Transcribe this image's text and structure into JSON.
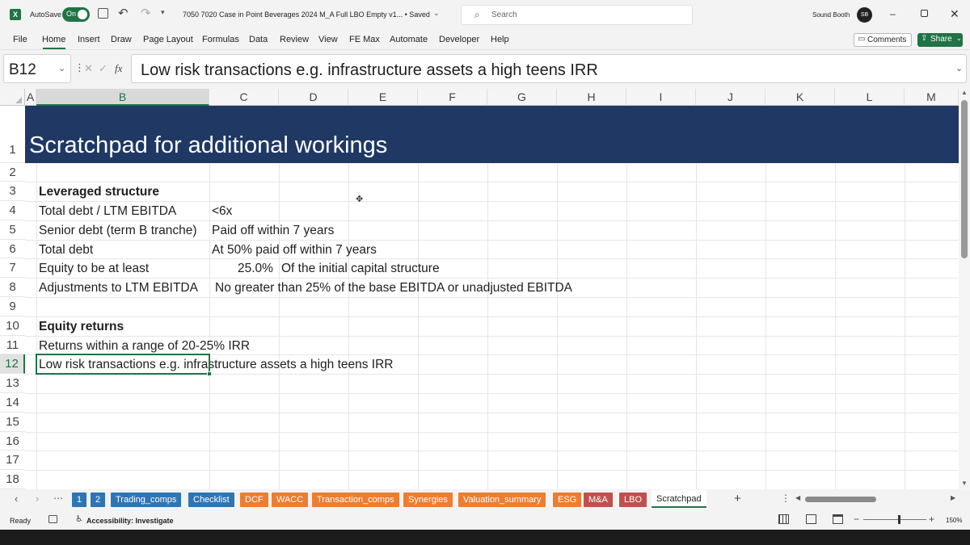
{
  "titlebar": {
    "autosave_label": "AutoSave",
    "autosave_state": "On",
    "document_title": "7050 7020 Case in Point Beverages 2024 M_A Full LBO Empty v1... • Saved",
    "search_placeholder": "Search",
    "user_name": "Sound Booth",
    "user_initials": "SB"
  },
  "ribbon": {
    "tabs": [
      "File",
      "Home",
      "Insert",
      "Draw",
      "Page Layout",
      "Formulas",
      "Data",
      "Review",
      "View",
      "FE Max",
      "Automate",
      "Developer",
      "Help"
    ],
    "comments_label": "Comments",
    "share_label": "Share"
  },
  "formula_bar": {
    "name_box": "B12",
    "fx_label": "fx",
    "content": "Low risk transactions e.g. infrastructure assets a high teens IRR"
  },
  "columns": [
    "A",
    "B",
    "C",
    "D",
    "E",
    "F",
    "G",
    "H",
    "I",
    "J",
    "K",
    "L",
    "M"
  ],
  "rows": [
    "1",
    "2",
    "3",
    "4",
    "5",
    "6",
    "7",
    "8",
    "9",
    "10",
    "11",
    "12",
    "13",
    "14",
    "15",
    "16",
    "17",
    "18"
  ],
  "cells": {
    "b1": "Scratchpad for additional workings",
    "b3": "Leveraged structure",
    "b4": "Total debt / LTM EBITDA",
    "c4": "<6x",
    "b5": "Senior debt (term B tranche)",
    "c5": "Paid off within 7 years",
    "b6": "Total debt",
    "c6": "At 50% paid off within 7 years",
    "b7": "Equity to be at least",
    "c7": "25.0%",
    "d7": "Of the initial capital structure",
    "b8": "Adjustments to LTM EBITDA",
    "c8": "No greater than 25% of the base EBITDA or unadjusted EBITDA",
    "b10": "Equity returns",
    "b11": "Returns within a range of 20-25% IRR",
    "b12": "Low risk transactions e.g. infrastructure assets a high teens IRR"
  },
  "sheet_tabs": [
    {
      "label": "1",
      "color": "#2e75b6"
    },
    {
      "label": "2",
      "color": "#2e75b6"
    },
    {
      "label": "Trading_comps",
      "color": "#2e75b6"
    },
    {
      "label": "Checklist",
      "color": "#2e75b6"
    },
    {
      "label": "DCF",
      "color": "#ed7d31"
    },
    {
      "label": "WACC",
      "color": "#ed7d31"
    },
    {
      "label": "Transaction_comps",
      "color": "#ed7d31"
    },
    {
      "label": "Synergies",
      "color": "#ed7d31"
    },
    {
      "label": "Valuation_summary",
      "color": "#ed7d31"
    },
    {
      "label": "ESG",
      "color": "#ed7d31"
    },
    {
      "label": "M&A",
      "color": "#c0504d"
    },
    {
      "label": "LBO",
      "color": "#c0504d"
    },
    {
      "label": "Scratchpad",
      "color": "#ffffff"
    }
  ],
  "statusbar": {
    "ready": "Ready",
    "accessibility": "Accessibility: Investigate",
    "zoom": "150%"
  },
  "colors": {
    "excel_green": "#217346",
    "header_banner": "#1f3864"
  }
}
